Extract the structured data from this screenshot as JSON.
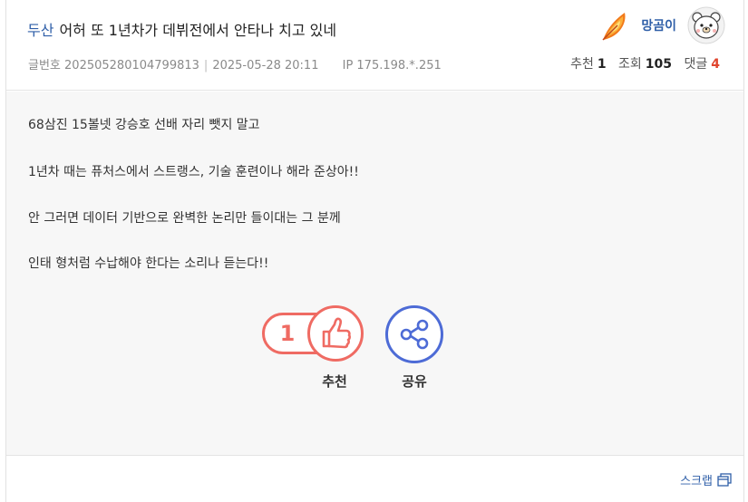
{
  "post": {
    "category": "두산",
    "title": "어허 또 1년차가 데뷔전에서 안타나 치고 있네",
    "id_label": "글번호",
    "id": "202505280104799813",
    "datetime": "2025-05-28 20:11",
    "ip": "IP 175.198.*.251"
  },
  "author": {
    "nickname": "망곰이",
    "badge_icon": "flame-feather-icon",
    "avatar_icon": "bear-avatar-icon"
  },
  "stats": {
    "reco_label": "추천",
    "reco": "1",
    "views_label": "조회",
    "views": "105",
    "comments_label": "댓글",
    "comments": "4"
  },
  "body": {
    "paragraphs": [
      "68삼진 15볼넷 강승호 선배 자리 뺏지 말고",
      "1년차 때는 퓨처스에서 스트랭스, 기술 훈련이나 해라 준상아!!",
      "안 그러면 데이터 기반으로 완벽한 논리만 들이대는 그 분께",
      "인태 형처럼 수납해야 한다는 소리나 듣는다!!"
    ]
  },
  "actions": {
    "reco_count": "1",
    "reco_label": "추천",
    "share_label": "공유",
    "scrap_label": "스크랩"
  },
  "colors": {
    "accent_blue": "#2f5fa8",
    "reco_red": "#ef6b63",
    "share_blue": "#4d6bd6",
    "comment_red": "#e0452e"
  }
}
